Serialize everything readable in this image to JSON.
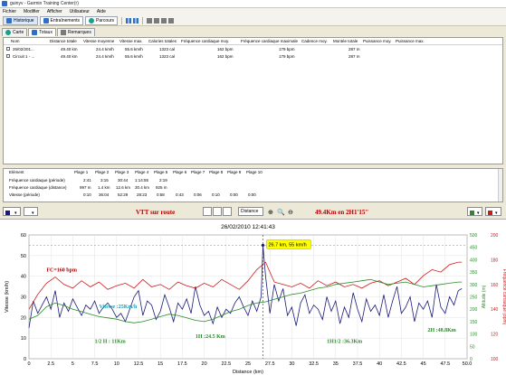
{
  "window": {
    "title": "guinyv - Garmin Training Center(r)"
  },
  "menu": [
    "Fichier",
    "Modifier",
    "Afficher",
    "Utilisateur",
    "Aide"
  ],
  "toolbar": {
    "historique": "Historique",
    "entrainements": "Entraînements",
    "parcours": "Parcours"
  },
  "subtabs": [
    "Carte",
    "Totaux",
    "Remarques"
  ],
  "list": {
    "headers": [
      "Nom",
      "Distance totale",
      "Vitesse moyenne",
      "Vitesse max.",
      "Calories totales",
      "Fréquence cardiaque moy.",
      "Fréquence cardiaque maximale",
      "Cadence moy.",
      "Montée totale",
      "Puissance moy.",
      "Puissance max."
    ],
    "rows": [
      [
        "26/02/201...",
        "49.40 km",
        "24.4 km/h",
        "55.6 km/h",
        "1323 cal",
        "162 bpm",
        "179 bpm",
        "",
        "287 m",
        "",
        ""
      ],
      [
        "Circuit 1 - ...",
        "49.40 km",
        "24.4 km/h",
        "55.6 km/h",
        "1323 cal",
        "162 bpm",
        "179 bpm",
        "",
        "287 m",
        "",
        ""
      ]
    ]
  },
  "zones": {
    "headers": [
      "Elément",
      "Plage 1",
      "Plage 2",
      "Plage 3",
      "Plage 4",
      "Plage 5",
      "Plage 6",
      "Plage 7",
      "Plage 8",
      "Plage 9",
      "Plage 10"
    ],
    "rows": [
      [
        "Fréquence cardiaque (période)",
        "2:41",
        "3:15",
        "30:44",
        "1:14:55",
        "2:19",
        "",
        "",
        "",
        "",
        ""
      ],
      [
        "Fréquence cardiaque (distance)",
        "997 m",
        "1.4 km",
        "12.6 km",
        "30.4 km",
        "925 m",
        "",
        "",
        "",
        "",
        ""
      ],
      [
        "Vitesse (période)",
        "0:10",
        "36:04",
        "52:29",
        "28:23",
        "0:58",
        "0:43",
        "0:06",
        "0:10",
        "0:00",
        "0:00"
      ]
    ]
  },
  "chart_toolbar": {
    "annotation_left": "VTT sur route",
    "annotation_right": "49.4Km en 2H1'15\"",
    "x_axis_select": "Distance"
  },
  "colors": {
    "speed": "#1a1a7a",
    "heart_rate": "#cc1a1a",
    "elevation": "#2a8a2a",
    "annotation": "#b00000",
    "callout": "#ffff00"
  },
  "chart_data": {
    "type": "line",
    "title": "26/02/2010 12:41:43",
    "xlabel": "Distance (km)",
    "ylabel": "Vitesse (km/h)",
    "ylabel_right_inner": "Altitude (m)",
    "ylabel_right_outer": "Fréquence cardiaque (bpm)",
    "xlim": [
      0,
      50
    ],
    "x_ticks": [
      "0",
      "2.5",
      "5",
      "7.5",
      "10",
      "12.5",
      "15",
      "17.5",
      "20",
      "22.5",
      "25",
      "27.5",
      "30",
      "32.5",
      "35",
      "37.5",
      "40",
      "42.5",
      "45",
      "47.5",
      "50.0"
    ],
    "ylim_left": [
      0,
      60
    ],
    "y_ticks_left": [
      "0",
      "10",
      "20",
      "30",
      "40",
      "50",
      "60"
    ],
    "ylim_right_inner": [
      0,
      500
    ],
    "y_ticks_right_inner": [
      "0",
      "50",
      "100",
      "150",
      "200",
      "250",
      "300",
      "350",
      "400",
      "450",
      "500"
    ],
    "ylim_right_outer": [
      100,
      200
    ],
    "y_ticks_right_outer": [
      "100",
      "120",
      "140",
      "160",
      "180",
      "200"
    ],
    "grid": true,
    "callout": "26.7 km, 55 km/h",
    "cursor_x": 26.7,
    "annotations": [
      {
        "text": "FC=160 bpm",
        "x": 2.0,
        "y": 42.3,
        "color": "#b00000"
      },
      {
        "text": "Vitesse :25Km/h",
        "x": 8.0,
        "y": 24.6,
        "color": "#1a9ab0"
      },
      {
        "text": "1/2 H : 11Km",
        "x": 7.5,
        "y": 7.7,
        "color": "#2a8a2a"
      },
      {
        "text": "1H :24.5 Km",
        "x": 19.0,
        "y": 10.0,
        "color": "#2a8a2a"
      },
      {
        "text": "1H1/2 :36.3Km",
        "x": 34.0,
        "y": 7.7,
        "color": "#2a8a2a"
      },
      {
        "text": "2H :48.8Km",
        "x": 45.5,
        "y": 13.1,
        "color": "#2a8a2a"
      }
    ],
    "series": [
      {
        "name": "Vitesse",
        "axis": "left",
        "color": "#1a1a7a",
        "x": [
          0,
          0.5,
          1,
          1.5,
          2,
          2.5,
          3,
          3.5,
          4,
          4.5,
          5,
          5.5,
          6,
          6.5,
          7,
          7.5,
          8,
          8.5,
          9,
          9.5,
          10,
          10.5,
          11,
          11.5,
          12,
          12.5,
          13,
          13.5,
          14,
          14.5,
          15,
          15.5,
          16,
          16.5,
          17,
          17.5,
          18,
          18.5,
          19,
          19.5,
          20,
          20.5,
          21,
          21.5,
          22,
          22.5,
          23,
          23.5,
          24,
          24.5,
          25,
          25.5,
          26,
          26.5,
          26.7,
          27,
          27.5,
          28,
          28.5,
          29,
          29.5,
          30,
          30.5,
          31,
          31.5,
          32,
          32.5,
          33,
          33.5,
          34,
          34.5,
          35,
          35.5,
          36,
          36.5,
          37,
          37.5,
          38,
          38.5,
          39,
          39.5,
          40,
          40.5,
          41,
          41.5,
          42,
          42.5,
          43,
          43.5,
          44,
          44.5,
          45,
          45.5,
          46,
          46.5,
          47,
          47.5,
          48,
          48.5,
          49,
          49.4
        ],
        "y": [
          15,
          28,
          22,
          26,
          30,
          24,
          33,
          20,
          27,
          23,
          29,
          25,
          21,
          26,
          24,
          28,
          22,
          25,
          27,
          24,
          20,
          22,
          18,
          24,
          30,
          33,
          21,
          28,
          26,
          19,
          23,
          31,
          25,
          18,
          27,
          24,
          29,
          22,
          35,
          26,
          21,
          23,
          17,
          25,
          20,
          24,
          22,
          27,
          30,
          25,
          21,
          28,
          23,
          30,
          55,
          40,
          22,
          36,
          28,
          34,
          21,
          25,
          16,
          27,
          31,
          22,
          26,
          24,
          19,
          30,
          23,
          28,
          17,
          25,
          20,
          32,
          24,
          18,
          29,
          23,
          26,
          21,
          31,
          20,
          28,
          35,
          22,
          25,
          30,
          18,
          27,
          24,
          28,
          20,
          36,
          25,
          22,
          30,
          26,
          33,
          34
        ]
      },
      {
        "name": "Fréquence cardiaque",
        "axis": "right_outer",
        "color": "#cc1a1a",
        "x": [
          0,
          1,
          2,
          3,
          4,
          5,
          6,
          7,
          8,
          9,
          10,
          11,
          12,
          13,
          14,
          15,
          16,
          17,
          18,
          19,
          20,
          21,
          22,
          23,
          24,
          25,
          26,
          27,
          28,
          29,
          30,
          31,
          32,
          33,
          34,
          35,
          36,
          37,
          38,
          39,
          40,
          41,
          42,
          43,
          44,
          45,
          46,
          47,
          48,
          49,
          49.4
        ],
        "y": [
          140,
          152,
          161,
          166,
          160,
          157,
          163,
          158,
          162,
          156,
          159,
          161,
          157,
          164,
          158,
          160,
          156,
          162,
          159,
          157,
          161,
          158,
          164,
          160,
          156,
          163,
          172,
          178,
          162,
          160,
          158,
          161,
          157,
          163,
          159,
          162,
          158,
          160,
          157,
          161,
          163,
          159,
          162,
          165,
          160,
          167,
          172,
          170,
          176,
          178,
          178
        ]
      },
      {
        "name": "Altitude",
        "axis": "right_inner",
        "color": "#2a8a2a",
        "x": [
          0,
          1,
          2,
          3,
          4,
          5,
          6,
          7,
          8,
          9,
          10,
          11,
          12,
          13,
          14,
          15,
          16,
          17,
          18,
          19,
          20,
          21,
          22,
          23,
          24,
          25,
          26,
          27,
          28,
          29,
          30,
          31,
          32,
          33,
          34,
          35,
          36,
          37,
          38,
          39,
          40,
          41,
          42,
          43,
          44,
          45,
          46,
          47,
          48,
          49,
          49.4
        ],
        "y": [
          160,
          175,
          210,
          225,
          215,
          200,
          190,
          180,
          170,
          165,
          160,
          150,
          145,
          150,
          160,
          170,
          180,
          175,
          165,
          155,
          150,
          160,
          175,
          190,
          200,
          215,
          225,
          230,
          240,
          250,
          260,
          265,
          275,
          285,
          290,
          300,
          305,
          310,
          315,
          320,
          310,
          300,
          305,
          310,
          300,
          290,
          295,
          300,
          305,
          310,
          310
        ]
      }
    ]
  }
}
